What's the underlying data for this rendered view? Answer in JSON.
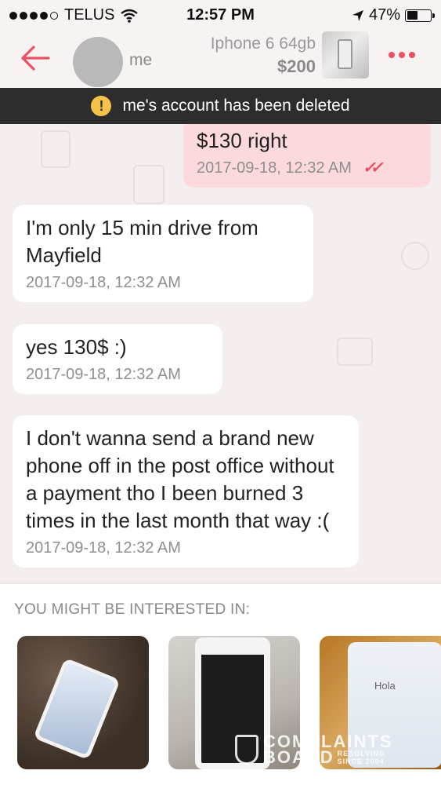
{
  "status_bar": {
    "carrier": "TELUS",
    "time": "12:57 PM",
    "battery": "47%",
    "battery_level": 0.47
  },
  "header": {
    "username": "me",
    "item_title": "Iphone 6 64gb",
    "item_price": "$200"
  },
  "banner": {
    "text": "me's account has been deleted"
  },
  "messages": [
    {
      "direction": "out",
      "text": "$130 right",
      "timestamp": "2017-09-18, 12:32 AM"
    },
    {
      "direction": "in",
      "text": "I'm only 15 min drive from Mayfield",
      "timestamp": "2017-09-18, 12:32 AM"
    },
    {
      "direction": "in",
      "text": "yes 130$ :)",
      "timestamp": "2017-09-18, 12:32 AM"
    },
    {
      "direction": "in",
      "text": "I don't wanna send a brand new phone off in the post office without a payment tho I been burned 3 times in the last month that way :(",
      "timestamp": "2017-09-18, 12:32 AM"
    }
  ],
  "suggestions": {
    "title": "YOU MIGHT BE INTERESTED IN:",
    "card3_screen_text": "Hola"
  },
  "watermark": {
    "line1": "COMPLAINTS",
    "line2": "BOARD",
    "sub1": "RESOLVING",
    "sub2": "SINCE 2004"
  },
  "colors": {
    "accent": "#ea5262",
    "outgoing_bubble": "#fbd9dc",
    "banner_bg": "#2d2d2d"
  }
}
